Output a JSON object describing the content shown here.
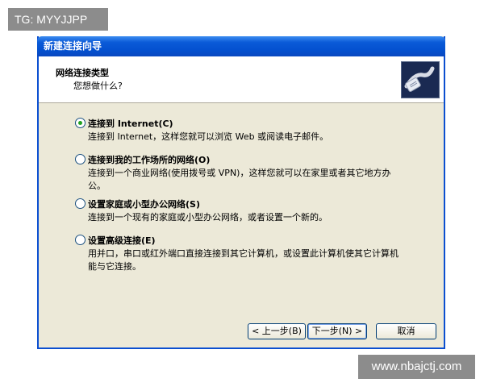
{
  "watermarks": {
    "top_left": "TG: MYYJJPP",
    "bottom_right": "www.nbajctj.com"
  },
  "window": {
    "title": "新建连接向导"
  },
  "header": {
    "title": "网络连接类型",
    "subtitle": "您想做什么?",
    "icon": "network-cable-icon"
  },
  "options": [
    {
      "label": "连接到 Internet(C)",
      "desc": "连接到 Internet，这样您就可以浏览 Web 或阅读电子邮件。",
      "selected": true
    },
    {
      "label": "连接到我的工作场所的网络(O)",
      "desc": "连接到一个商业网络(使用拨号或 VPN)，这样您就可以在家里或者其它地方办公。",
      "selected": false
    },
    {
      "label": "设置家庭或小型办公网络(S)",
      "desc": "连接到一个现有的家庭或小型办公网络，或者设置一个新的。",
      "selected": false
    },
    {
      "label": "设置高级连接(E)",
      "desc": "用并口，串口或红外端口直接连接到其它计算机，或设置此计算机使其它计算机能与它连接。",
      "selected": false
    }
  ],
  "buttons": {
    "back": "< 上一步(B)",
    "next": "下一步(N) >",
    "cancel": "取消"
  }
}
